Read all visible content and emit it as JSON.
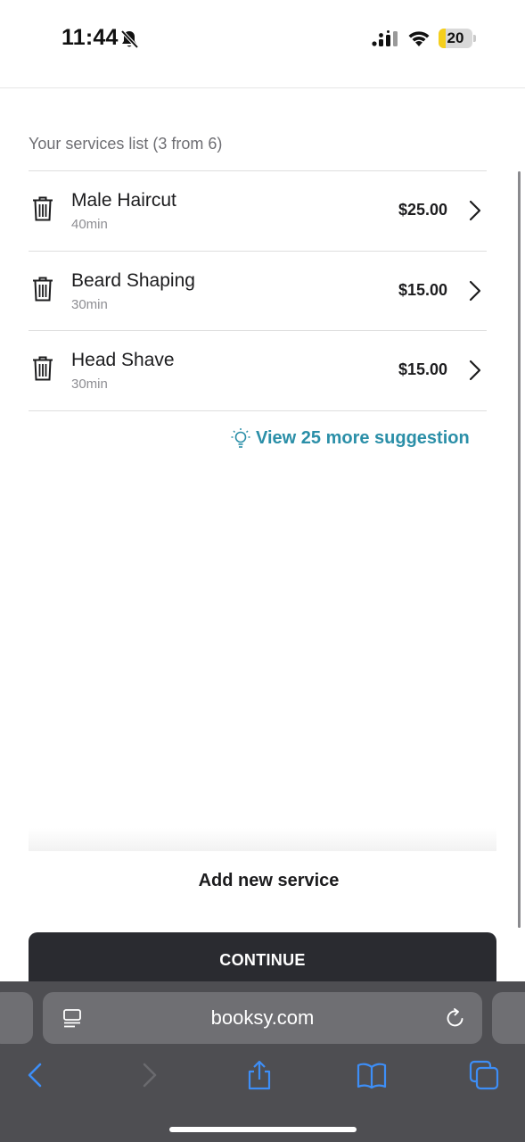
{
  "status_bar": {
    "time": "11:44",
    "battery_level": "20",
    "battery_fraction": 0.2
  },
  "services": {
    "list_title": "Your services list (3 from 6)",
    "items": [
      {
        "name": "Male Haircut",
        "duration": "40min",
        "price": "$25.00"
      },
      {
        "name": "Beard Shaping",
        "duration": "30min",
        "price": "$15.00"
      },
      {
        "name": "Head Shave",
        "duration": "30min",
        "price": "$15.00"
      }
    ],
    "suggestion_link": "View 25 more suggestion",
    "add_service_label": "Add new service",
    "continue_label": "CONTINUE"
  },
  "browser": {
    "address": "booksy.com"
  },
  "colors": {
    "accent_teal": "#2b8fa8",
    "toolbar_icon_blue": "#3d8ef7",
    "button_dark": "#2a2b30",
    "battery_yellow": "#f5cf1d"
  },
  "icons": [
    "bell-slash-icon",
    "signal-icon",
    "wifi-icon",
    "battery-icon",
    "trash-icon",
    "chevron-right-icon",
    "lightbulb-icon",
    "reader-icon",
    "reload-icon",
    "back-icon",
    "forward-icon",
    "share-icon",
    "bookmarks-icon",
    "tabs-icon"
  ]
}
